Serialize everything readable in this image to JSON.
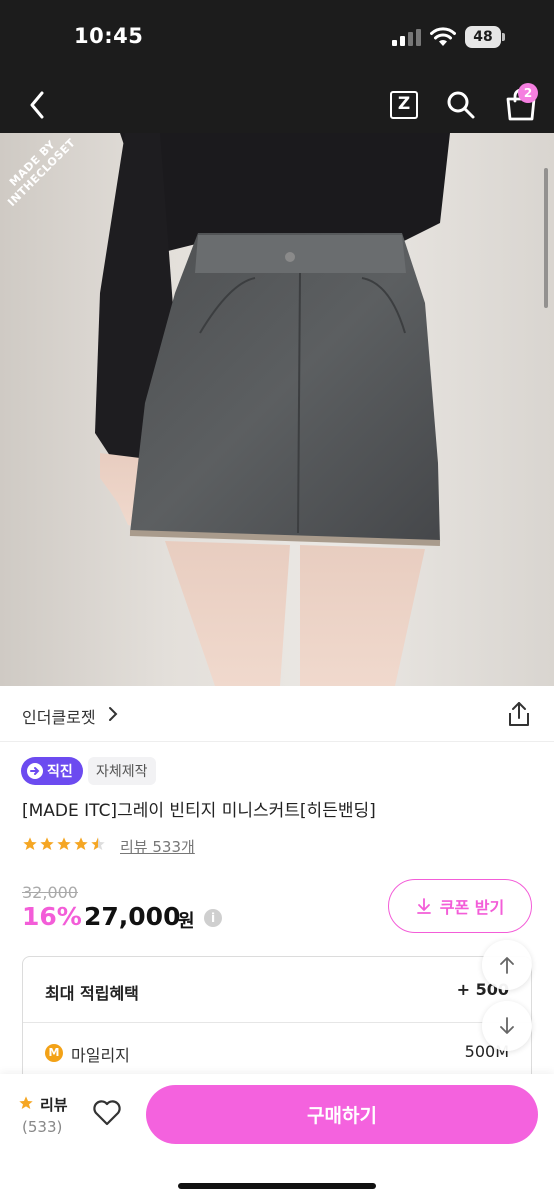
{
  "status_bar": {
    "time": "10:45",
    "battery": "48"
  },
  "header": {
    "back_icon": "chevron-left-icon",
    "z_label": "Z",
    "cart_badge": "2"
  },
  "photo": {
    "watermark_line1": "MADE BY",
    "watermark_line2": "INTHECLOSET"
  },
  "brand": {
    "name": "인더클로젯"
  },
  "tags": {
    "direct": "직진",
    "own_made": "자체제작"
  },
  "product": {
    "title": "[MADE ITC]그레이 빈티지 미니스커트[히든밴딩]",
    "rating": 4.5,
    "review_link": "리뷰 533개",
    "original_price": "32,000",
    "discount": "16%",
    "price": "27,000",
    "price_unit": "원",
    "info_symbol": "i"
  },
  "coupon": {
    "label": "쿠폰 받기"
  },
  "reward": {
    "title": "최대 적립혜택",
    "total": "+ 500",
    "mileage_symbol": "M",
    "mileage_label": "마일리지",
    "mileage_value": "500M"
  },
  "bottom_bar": {
    "review_label": "리뷰",
    "review_count": "(533)",
    "buy_label": "구매하기"
  },
  "colors": {
    "accent_pink": "#f35dd8",
    "direct_tag_purple": "#6c4bf0",
    "star_orange": "#f5a623"
  }
}
